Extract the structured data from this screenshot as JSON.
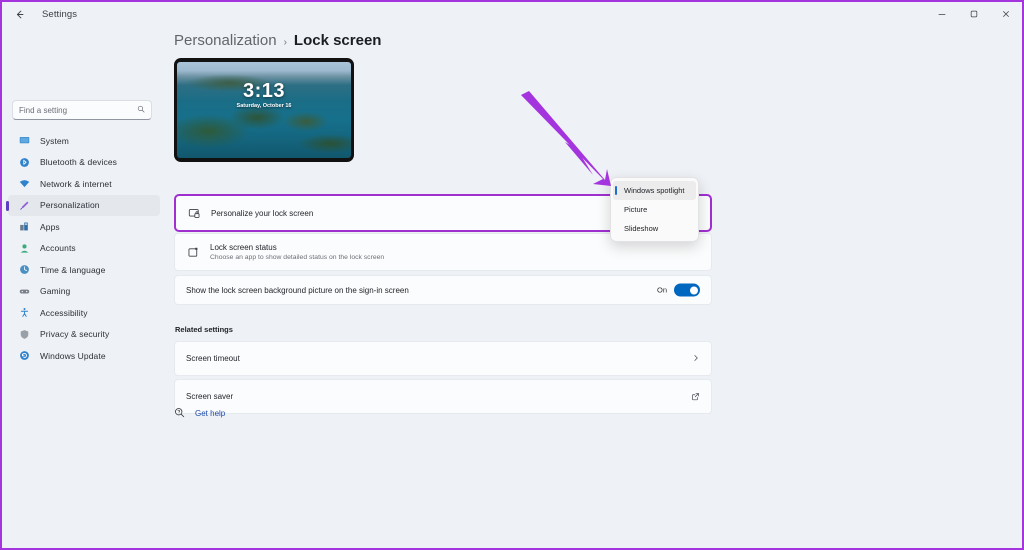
{
  "titlebar": {
    "back_icon": "back-arrow-icon",
    "title": "Settings",
    "minimize": "–",
    "maximize": "❐",
    "close": "×"
  },
  "search": {
    "placeholder": "Find a setting",
    "icon": "search-icon",
    "value": ""
  },
  "sidebar": {
    "items": [
      {
        "label": "System",
        "icon": "monitor-icon",
        "color": "#2f82cc",
        "glyph": "▬",
        "selected": false
      },
      {
        "label": "Bluetooth & devices",
        "icon": "bluetooth-icon",
        "color": "#2f82cc",
        "glyph": "ᛗ",
        "selected": false
      },
      {
        "label": "Network & internet",
        "icon": "wifi-icon",
        "color": "#2f82cc",
        "glyph": "▼",
        "selected": false
      },
      {
        "label": "Personalization",
        "icon": "paintbrush-icon",
        "color": "#8a5bd6",
        "glyph": "╱",
        "selected": true
      },
      {
        "label": "Apps",
        "icon": "apps-icon",
        "color": "#3e6fa8",
        "glyph": "▦",
        "selected": false
      },
      {
        "label": "Accounts",
        "icon": "person-icon",
        "color": "#3aab7a",
        "glyph": "●",
        "selected": false
      },
      {
        "label": "Time & language",
        "icon": "clock-globe-icon",
        "color": "#4a90c2",
        "glyph": "◔",
        "selected": false
      },
      {
        "label": "Gaming",
        "icon": "gamepad-icon",
        "color": "#7a8089",
        "glyph": "▭",
        "selected": false
      },
      {
        "label": "Accessibility",
        "icon": "accessibility-icon",
        "color": "#2f82cc",
        "glyph": "Ʌ",
        "selected": false
      },
      {
        "label": "Privacy & security",
        "icon": "shield-icon",
        "color": "#9aa0a8",
        "glyph": "◆",
        "selected": false
      },
      {
        "label": "Windows Update",
        "icon": "update-icon",
        "color": "#2f82cc",
        "glyph": "⟳",
        "selected": false
      }
    ]
  },
  "breadcrumb": {
    "parent": "Personalization",
    "separator": "›",
    "current": "Lock screen"
  },
  "preview": {
    "name": "lock-screen-preview",
    "clock": "3:13",
    "date": "Saturday, October 16"
  },
  "settings": {
    "personalize": {
      "title": "Personalize your lock screen",
      "icon": "monitor-lock-icon"
    },
    "lock_screen_status": {
      "title": "Lock screen status",
      "subtitle": "Choose an app to show detailed status on the lock screen",
      "icon": "status-square-icon"
    },
    "signin_background": {
      "title": "Show the lock screen background picture on the sign-in screen",
      "toggle_label": "On",
      "toggle_state": "on"
    }
  },
  "related": {
    "label": "Related settings",
    "items": [
      {
        "title": "Screen timeout",
        "icon": "chevron-right-icon"
      },
      {
        "title": "Screen saver",
        "icon": "external-link-icon"
      }
    ]
  },
  "get_help": {
    "label": "Get help",
    "icon": "help-icon"
  },
  "dropdown": {
    "name": "personalize-lock-screen-dropdown",
    "options": [
      {
        "label": "Windows spotlight",
        "selected": true
      },
      {
        "label": "Picture",
        "selected": false
      },
      {
        "label": "Slideshow",
        "selected": false
      }
    ]
  },
  "annotation": {
    "arrow": "purple-arrow-annotation",
    "color": "#a434dd"
  },
  "colors": {
    "accent_blue": "#0067c0",
    "annotation_purple": "#a434dd",
    "highlight_purple": "#a02fd0",
    "page_background": "#eef1f5",
    "card_background": "#fbfcfd",
    "link_blue": "#1c49a8"
  }
}
